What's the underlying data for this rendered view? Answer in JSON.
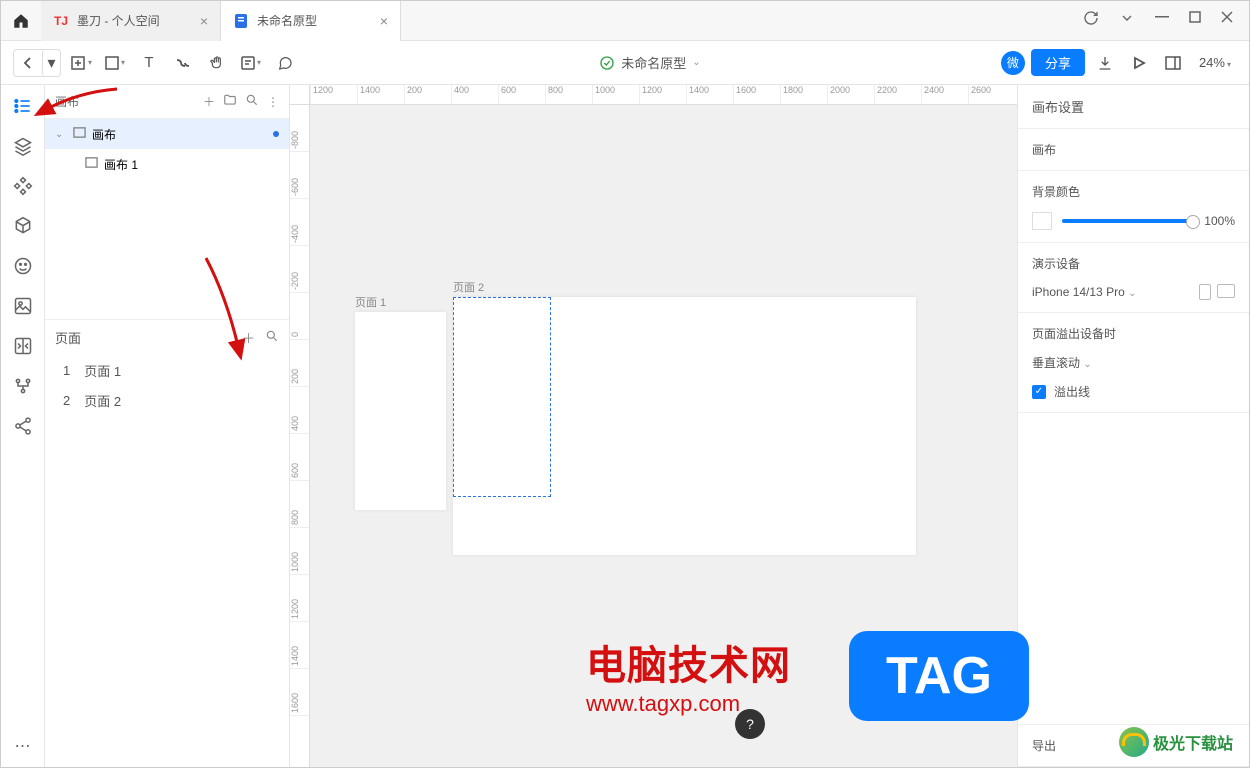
{
  "tabs": [
    {
      "label": "墨刀 - 个人空间",
      "icon_color": "#e33",
      "active": false
    },
    {
      "label": "未命名原型",
      "icon_color": "#2a71e8",
      "active": true
    }
  ],
  "doc_title": "未命名原型",
  "toolbar": {
    "wei": "微",
    "share": "分享",
    "zoom": "24%"
  },
  "left": {
    "canvas_header": "画布",
    "tree_root": "画布",
    "tree_child": "画布 1",
    "pages_header": "页面",
    "pages": [
      "页面 1",
      "页面 2"
    ]
  },
  "ruler_h": [
    "1200",
    "1400",
    "200",
    "400",
    "600",
    "800",
    "1000",
    "1200",
    "1400",
    "1600",
    "1800",
    "2000",
    "2200",
    "2400",
    "2600"
  ],
  "ruler_v": [
    "-800",
    "-600",
    "-400",
    "-200",
    "0",
    "200",
    "400",
    "600",
    "800",
    "1000",
    "1200",
    "1400",
    "1600"
  ],
  "artboards": {
    "p1": "页面 1",
    "p2": "页面 2"
  },
  "right": {
    "title": "画布设置",
    "canvas": "画布",
    "bgcolor": "背景颜色",
    "opacity": "100%",
    "device_header": "演示设备",
    "device": "iPhone 14/13 Pro",
    "overflow_header": "页面溢出设备时",
    "scroll": "垂直滚动",
    "overflow_line": "溢出线",
    "export": "导出"
  },
  "watermark": {
    "line1": "电脑技术网",
    "line2": "www.tagxp.com",
    "tag": "TAG",
    "jg": "极光下载站"
  }
}
